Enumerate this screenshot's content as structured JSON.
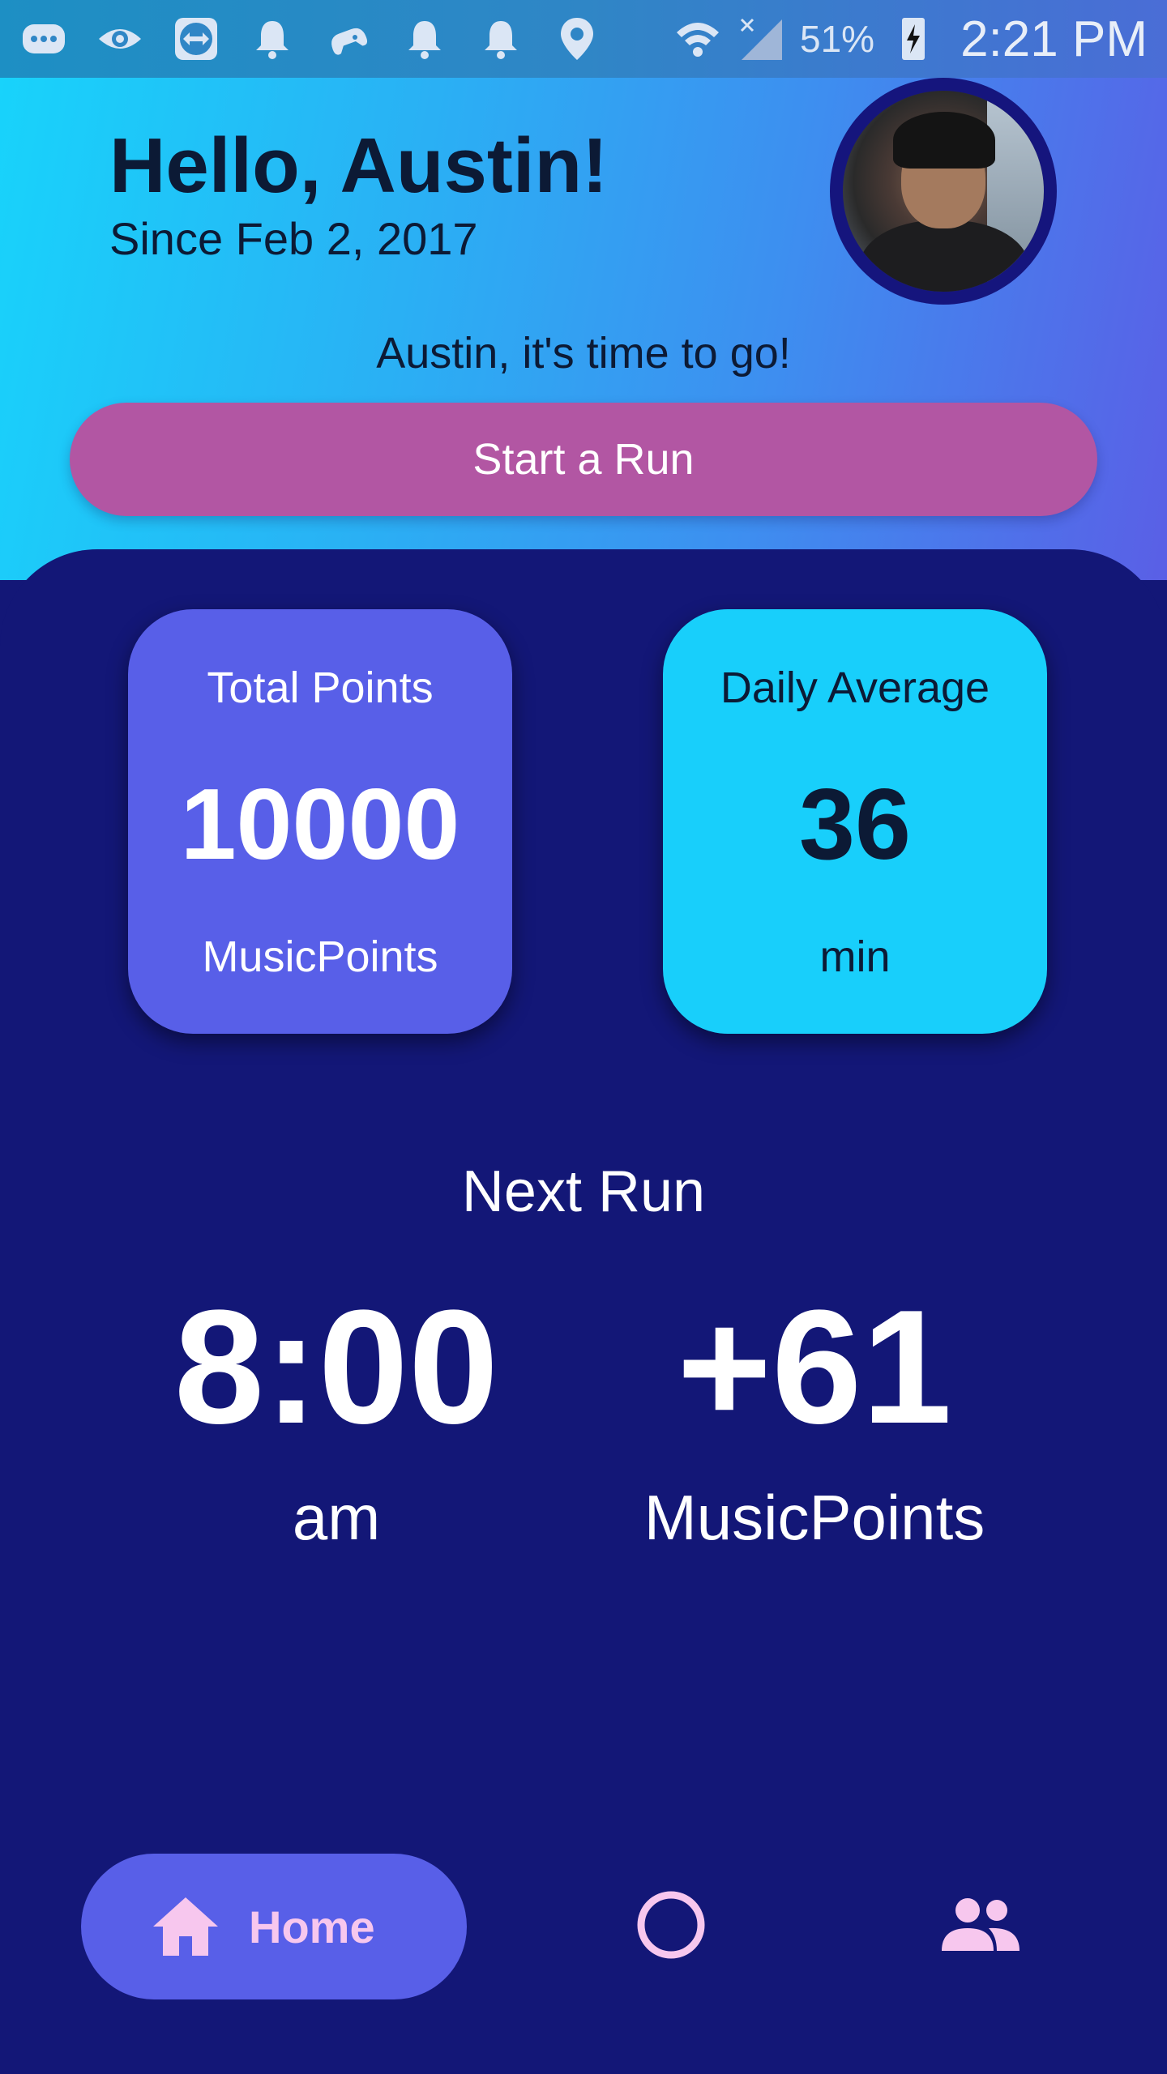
{
  "status_bar": {
    "icons": [
      "message-icon",
      "eye-icon",
      "teamviewer-icon",
      "notification-icon",
      "game-icon",
      "notification-icon",
      "notification-icon",
      "location-icon",
      "wifi-icon",
      "signal-icon",
      "battery-charging-icon"
    ],
    "battery": "51%",
    "time": "2:21 PM"
  },
  "header": {
    "greeting": "Hello, Austin!",
    "since": "Since Feb 2, 2017",
    "tagline": "Austin, it's time to go!",
    "start_button": "Start a Run"
  },
  "stats": {
    "total_points": {
      "title": "Total Points",
      "value": "10000",
      "unit": "MusicPoints"
    },
    "daily_average": {
      "title": "Daily Average",
      "value": "36",
      "unit": "min"
    }
  },
  "next_run": {
    "title": "Next Run",
    "time": {
      "value": "8:00",
      "unit": "am"
    },
    "bonus": {
      "value": "+61",
      "unit": "MusicPoints"
    }
  },
  "nav": {
    "home_label": "Home",
    "items": [
      "home-icon",
      "run-icon",
      "friends-icon"
    ]
  },
  "colors": {
    "panel": "#131777",
    "start_button": "#b256a3",
    "points_card": "#585fe8",
    "daily_card": "#18cffb",
    "nav_accent": "#f7c7ee"
  }
}
